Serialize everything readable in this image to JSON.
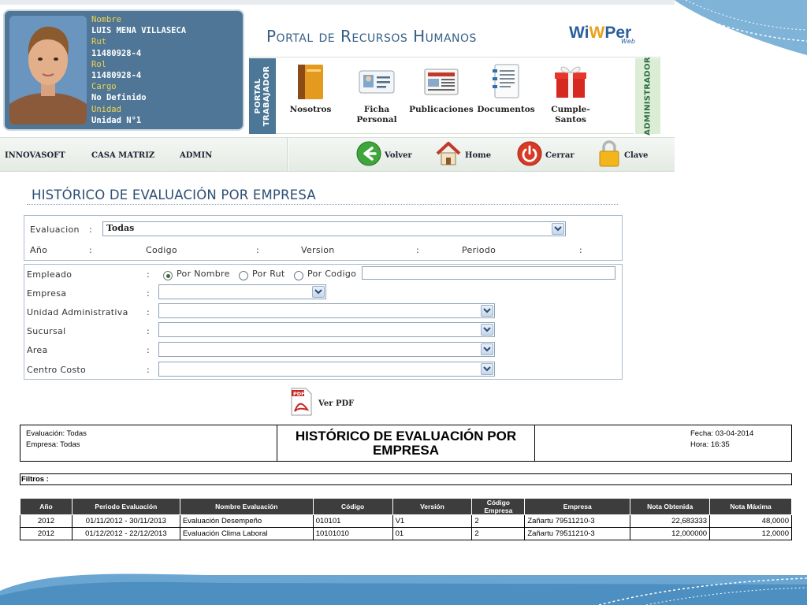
{
  "profile": {
    "fields": [
      {
        "label": "Nombre",
        "value": "LUIS MENA VILLASECA"
      },
      {
        "label": "Rut",
        "value": "11480928-4"
      },
      {
        "label": "Rol",
        "value": "11480928-4"
      },
      {
        "label": "Cargo",
        "value": "No Definido"
      },
      {
        "label": "Unidad",
        "value": "Unidad N°1"
      }
    ]
  },
  "header": {
    "portal_title": "Portal de Recursos Humanos",
    "logo_main_a": "Wi",
    "logo_main_b": "W",
    "logo_main_c": "Per",
    "logo_sub": "Web",
    "side_left_line1": "PORTAL",
    "side_left_line2": "TRABAJADOR",
    "side_right": "ADMINISTRADOR"
  },
  "menu": [
    {
      "label": "Nosotros",
      "icon": "book-icon"
    },
    {
      "label": "Ficha Personal",
      "icon": "id-card-icon"
    },
    {
      "label": "Publicaciones",
      "icon": "newspaper-icon"
    },
    {
      "label": "Documentos",
      "icon": "document-icon"
    },
    {
      "label": "Cumple-Santos",
      "icon": "gift-icon"
    }
  ],
  "nav": {
    "links": [
      "INNOVASOFT",
      "CASA MATRIZ",
      "ADMIN"
    ],
    "actions": [
      {
        "label": "Volver",
        "icon": "back-arrow-icon"
      },
      {
        "label": "Home",
        "icon": "home-icon"
      },
      {
        "label": "Cerrar",
        "icon": "power-icon"
      },
      {
        "label": "Clave",
        "icon": "lock-icon"
      }
    ]
  },
  "page": {
    "title": "HISTÓRICO DE EVALUACIÓN POR EMPRESA"
  },
  "filters": {
    "evaluacion_label": "Evaluacion",
    "evaluacion_value": "Todas",
    "anio_label": "Año",
    "codigo_label": "Codigo",
    "version_label": "Version",
    "periodo_label": "Periodo",
    "colon": ":",
    "empleado_label": "Empleado",
    "radio_nombre": "Por Nombre",
    "radio_rut": "Por Rut",
    "radio_codigo": "Por Codigo",
    "radio_selected": "Por Nombre",
    "empresa_label": "Empresa",
    "unidad_label": "Unidad Administrativa",
    "sucursal_label": "Sucursal",
    "area_label": "Area",
    "centro_label": "Centro Costo",
    "ver_pdf": "Ver PDF",
    "pdf_icon_text": "PDF"
  },
  "report": {
    "evaluacion": "Evaluación: Todas",
    "empresa": "Empresa: Todas",
    "title": "HISTÓRICO DE EVALUACIÓN POR EMPRESA",
    "fecha": "Fecha: 03-04-2014",
    "hora": "Hora: 16:35",
    "filtros": "Filtros :",
    "columns": [
      "Año",
      "Periodo Evaluación",
      "Nombre Evaluación",
      "Código",
      "Versión",
      "Código Empresa",
      "Empresa",
      "Nota Obtenida",
      "Nota Máxima"
    ],
    "rows": [
      [
        "2012",
        "01/11/2012 - 30/11/2013",
        "Evaluación Desempeño",
        "010101",
        "V1",
        "2",
        "Zañartu 79511210-3",
        "22,683333",
        "48,0000"
      ],
      [
        "2012",
        "01/12/2012 - 22/12/2013",
        "Evaluación Clima Laboral",
        "10101010",
        "01",
        "2",
        "Zañartu 79511210-3",
        "12,000000",
        "12,0000"
      ]
    ]
  },
  "colors": {
    "brand_blue": "#4f7696",
    "label_yellow": "#f2d44e",
    "title_blue": "#2d4f73",
    "admin_green": "#dbeed5"
  }
}
